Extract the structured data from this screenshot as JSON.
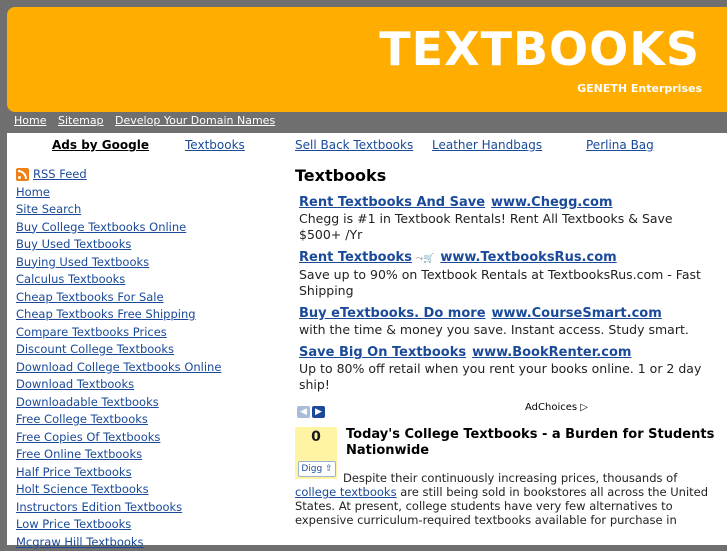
{
  "header": {
    "title": "TEXTBOOKS",
    "subtitle": "GENETH Enterprises",
    "colors": {
      "header_bg": "#ffad00",
      "page_bg": "#6f6f6f",
      "link": "#1a4a99"
    }
  },
  "topnav": [
    "Home",
    "Sitemap",
    "Develop Your Domain Names"
  ],
  "adlinks": {
    "label": "Ads by Google",
    "links": [
      "Textbooks",
      "Sell Back Textbooks",
      "Leather Handbags",
      "Perlina Bag"
    ]
  },
  "sidebar": {
    "rss_label": "RSS Feed",
    "items": [
      "Home",
      "Site Search",
      "Buy College Textbooks Online",
      "Buy Used Textbooks",
      "Buying Used Textbooks",
      "Calculus Textbooks",
      "Cheap Textbooks For Sale",
      "Cheap Textbooks Free Shipping",
      "Compare Textbooks Prices",
      "Discount College Textbooks",
      "Download College Textbooks Online",
      "Download Textbooks",
      "Downloadable Textbooks",
      "Free College Textbooks",
      "Free Copies Of Textbooks",
      "Free Online Textbooks",
      "Half Price Textbooks",
      "Holt Science Textbooks",
      "Instructors Edition Textbooks",
      "Low Price Textbooks",
      "Mcgraw Hill Textbooks"
    ]
  },
  "main": {
    "title": "Textbooks",
    "ads": [
      {
        "headline": "Rent Textbooks And Save",
        "url": "www.Chegg.com",
        "text": "Chegg is #1 in Textbook Rentals! Rent All Textbooks & Save $500+ /Yr"
      },
      {
        "headline": "Rent Textbooks",
        "url": "www.TextbooksRus.com",
        "text": "Save up to 90% on Textbook Rentals at TextbooksRus.com - Fast Shipping"
      },
      {
        "headline": "Buy eTextbooks. Do more",
        "url": "www.CourseSmart.com",
        "text": "with the time & money you save. Instant access. Study smart."
      },
      {
        "headline": "Save Big On Textbooks",
        "url": "www.BookRenter.com",
        "text": "Up to 80% off retail when you rent your books online. 1 or 2 day ship!"
      }
    ],
    "adchoices": "AdChoices",
    "article": {
      "digg_count": "0",
      "digg_label": "Digg",
      "title": "Today's College Textbooks - a Burden for Students Nationwide",
      "body_1": "Despite their continuously increasing prices, thousands of",
      "body_link": "college textbooks",
      "body_2": "are still being sold in bookstores all across the United States. At present, college students have very few alternatives to expensive curriculum-required textbooks available for purchase in"
    }
  }
}
